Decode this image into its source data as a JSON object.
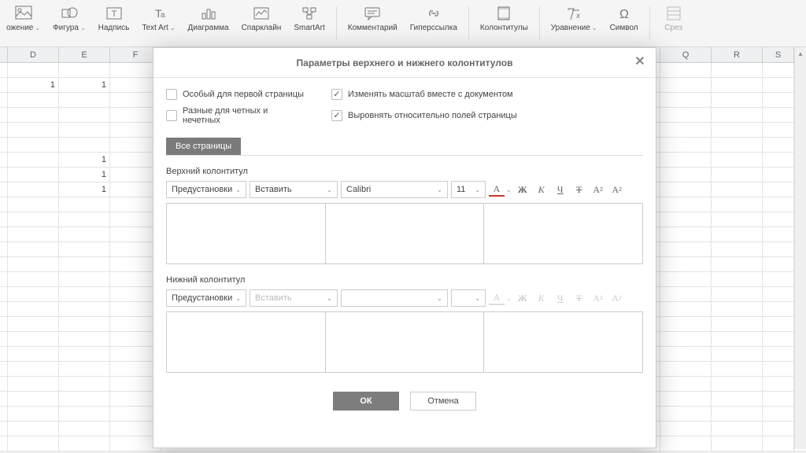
{
  "ribbon": {
    "items": [
      {
        "label": "ожение",
        "has_chev": true
      },
      {
        "label": "Фигура",
        "has_chev": true
      },
      {
        "label": "Надпись",
        "has_chev": false
      },
      {
        "label": "Text Art",
        "has_chev": true
      },
      {
        "label": "Диаграмма",
        "has_chev": false
      },
      {
        "label": "Спарклайн",
        "has_chev": false
      },
      {
        "label": "SmartArt",
        "has_chev": false
      },
      {
        "label": "Комментарий",
        "has_chev": false
      },
      {
        "label": "Гиперссылка",
        "has_chev": false
      },
      {
        "label": "Колонтитулы",
        "has_chev": false
      },
      {
        "label": "Уравнение",
        "has_chev": true
      },
      {
        "label": "Символ",
        "has_chev": false
      },
      {
        "label": "Срез",
        "has_chev": false
      }
    ]
  },
  "grid": {
    "columns": [
      "D",
      "E",
      "F",
      "Q",
      "R",
      "S"
    ],
    "cell_values": {
      "r2c1": "1",
      "r2c2": "1",
      "r7c2": "1",
      "r8c2": "1",
      "r9c2": "1"
    }
  },
  "dialog": {
    "title": "Параметры верхнего и нижнего колонтитулов",
    "checks": {
      "first_page": {
        "label": "Особый для первой страницы",
        "checked": false
      },
      "scale": {
        "label": "Изменять масштаб вместе с документом",
        "checked": true
      },
      "odd_even": {
        "label": "Разные для четных и нечетных",
        "checked": false
      },
      "align": {
        "label": "Выровнять относительно полей страницы",
        "checked": true
      }
    },
    "tab": {
      "all": "Все страницы"
    },
    "header": {
      "title": "Верхний колонтитул",
      "presets": "Предустановки",
      "insert": "Вставить",
      "font": "Calibri",
      "size": "11"
    },
    "footer": {
      "title": "Нижний колонтитул",
      "presets": "Предустановки",
      "insert": "Вставить",
      "font": "",
      "size": ""
    },
    "buttons": {
      "ok": "ОК",
      "cancel": "Отмена"
    }
  }
}
